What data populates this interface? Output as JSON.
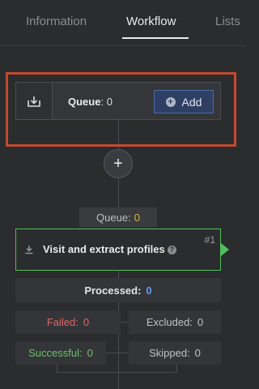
{
  "tabs": {
    "information": "Information",
    "workflow": "Workflow",
    "lists": "Lists"
  },
  "queue_box": {
    "label": "Queue",
    "value": ": 0",
    "add_label": "Add"
  },
  "add_step": {
    "symbol": "+"
  },
  "queue_pill": {
    "label": "Queue:",
    "value": "0"
  },
  "step": {
    "title": "Visit and extract profiles",
    "number": "#1"
  },
  "stats": {
    "processed_label": "Processed:",
    "processed_value": "0",
    "failed_label": "Failed:",
    "failed_value": "0",
    "excluded_label": "Excluded:",
    "excluded_value": "0",
    "successful_label": "Successful:",
    "successful_value": "0",
    "skipped_label": "Skipped:",
    "skipped_value": "0"
  },
  "colors": {
    "highlight": "#c24a2e",
    "step_border": "#4fbf5e",
    "add_button": "#2f3f63",
    "queue_value": "#d9b24b",
    "processed_value": "#5b9bf0",
    "failed": "#d86a6a",
    "successful": "#6cc26a"
  },
  "icons": {
    "queue": "download-tray-icon",
    "add": "plus-circle-icon",
    "step": "download-icon",
    "help": "help-icon"
  }
}
